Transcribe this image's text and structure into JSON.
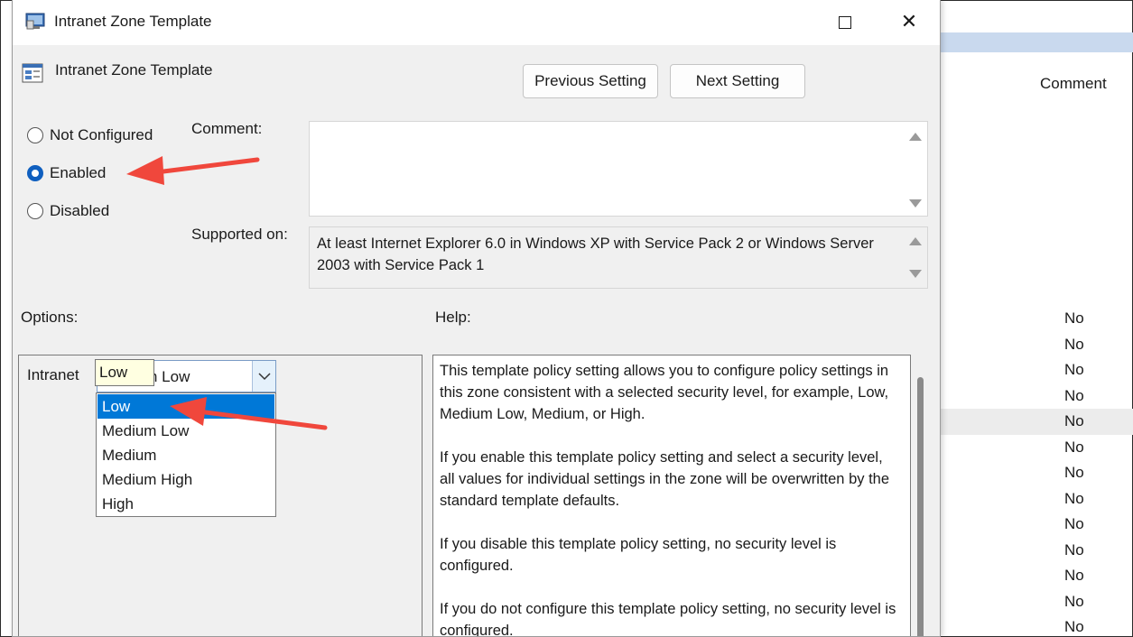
{
  "background": {
    "column_header": "Comment",
    "values": [
      "No",
      "No",
      "No",
      "No",
      "No",
      "No",
      "No",
      "No",
      "No",
      "No",
      "No",
      "No",
      "No"
    ]
  },
  "dialog": {
    "title": "Intranet Zone Template",
    "policy_name": "Intranet Zone Template",
    "buttons": {
      "previous": "Previous Setting",
      "next": "Next Setting"
    },
    "state": {
      "options": [
        {
          "label": "Not Configured",
          "checked": false
        },
        {
          "label": "Enabled",
          "checked": true
        },
        {
          "label": "Disabled",
          "checked": false
        }
      ]
    },
    "comment_label": "Comment:",
    "comment_value": "",
    "supported_label": "Supported on:",
    "supported_text": "At least Internet Explorer 6.0 in Windows XP with Service Pack 2 or Windows Server 2003 with Service Pack 1",
    "options_label": "Options:",
    "help_label": "Help:",
    "options": {
      "field_label": "Intranet",
      "combo_value": "Medium Low",
      "tooltip": "Low",
      "dropdown_items": [
        "Low",
        "Medium Low",
        "Medium",
        "Medium High",
        "High"
      ],
      "highlighted_item": "Low"
    },
    "help": [
      "This template policy setting allows you to configure policy settings in this zone consistent with a selected security level, for example, Low, Medium Low, Medium, or High.",
      "If you enable this template policy setting and select a security level, all values for individual settings in the zone will be overwritten by the standard template defaults.",
      "If you disable this template policy setting, no security level is configured.",
      "If you do not configure this template policy setting, no security level is configured."
    ]
  },
  "colors": {
    "accent": "#0078d7",
    "radio_checked": "#0f5fbf",
    "annotation_arrow": "#f0473c",
    "dialog_bg": "#f0f0f0"
  },
  "icons": [
    "app-window-icon",
    "policy-icon",
    "maximize-icon",
    "close-icon",
    "chevron-down-icon",
    "scroll-up-icon",
    "scroll-down-icon",
    "annotation-arrow-icon"
  ]
}
